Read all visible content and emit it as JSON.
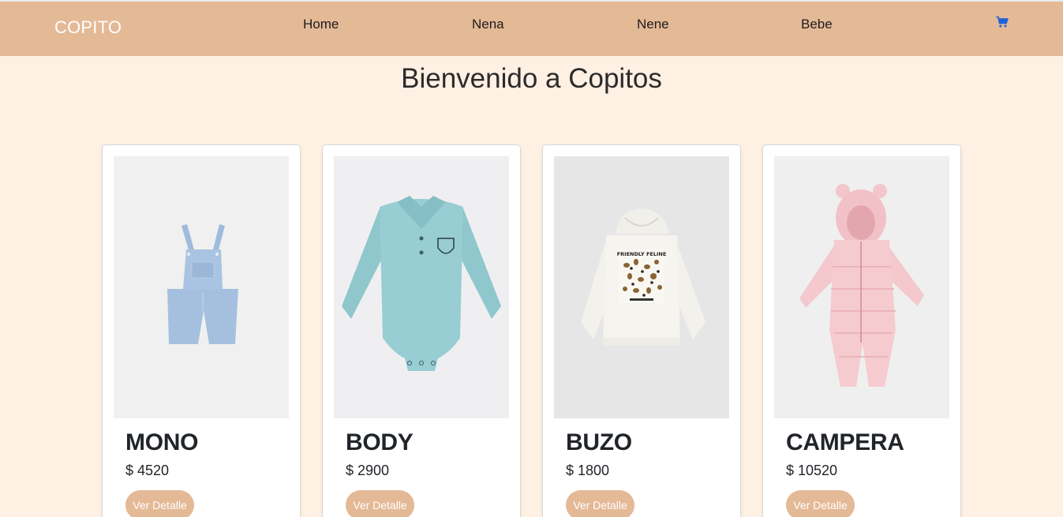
{
  "brand": "COPITO",
  "nav": [
    {
      "label": "Home"
    },
    {
      "label": "Nena"
    },
    {
      "label": "Nene"
    },
    {
      "label": "Bebe"
    }
  ],
  "cart_icon": "shopping-cart-icon",
  "colors": {
    "navbar": "#e4b996",
    "page_background": "#fef0e3",
    "button": "#e4b996",
    "cart_icon": "#1e63d6"
  },
  "welcome": "Bienvenido a Copitos",
  "products": [
    {
      "title": "MONO",
      "price": "$ 4520",
      "button": "Ver Detalle",
      "image": "denim-overalls"
    },
    {
      "title": "BODY",
      "price": "$ 2900",
      "button": "Ver Detalle",
      "image": "teal-polo-bodysuit"
    },
    {
      "title": "BUZO",
      "price": "$ 1800",
      "button": "Ver Detalle",
      "image": "white-hoodie-leopard-print",
      "image_text": "FRIENDLY FELINE"
    },
    {
      "title": "CAMPERA",
      "price": "$ 10520",
      "button": "Ver Detalle",
      "image": "pink-puffer-snowsuit"
    }
  ]
}
